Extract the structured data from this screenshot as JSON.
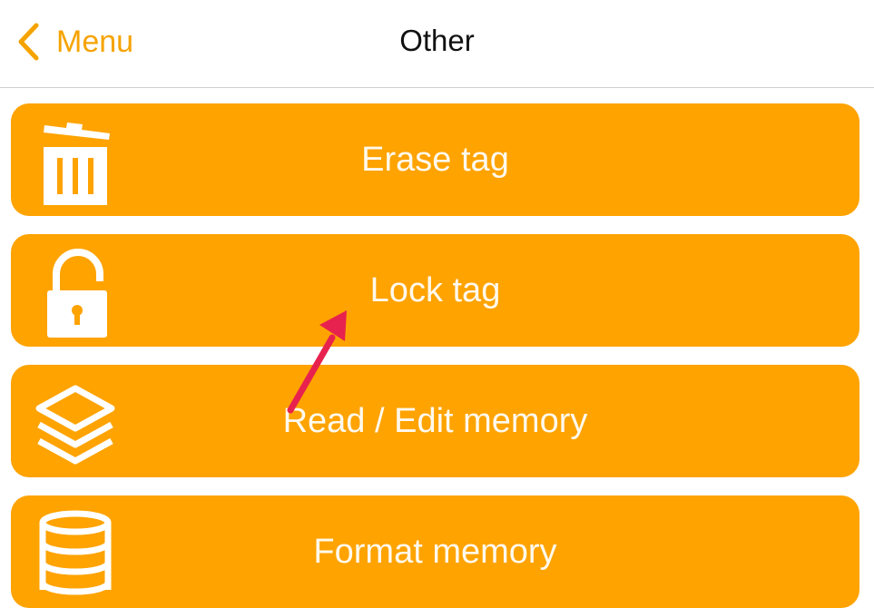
{
  "nav": {
    "back_label": "Menu",
    "title": "Other"
  },
  "menu": {
    "items": [
      {
        "label": "Erase tag",
        "icon": "trash-icon"
      },
      {
        "label": "Lock tag",
        "icon": "lock-icon"
      },
      {
        "label": "Read / Edit memory",
        "icon": "layers-icon"
      },
      {
        "label": "Format memory",
        "icon": "database-icon"
      }
    ]
  },
  "colors": {
    "accent": "#f5a300",
    "button_background": "#fea300",
    "button_text": "#ffffff",
    "annotation_arrow": "#e8224e"
  }
}
